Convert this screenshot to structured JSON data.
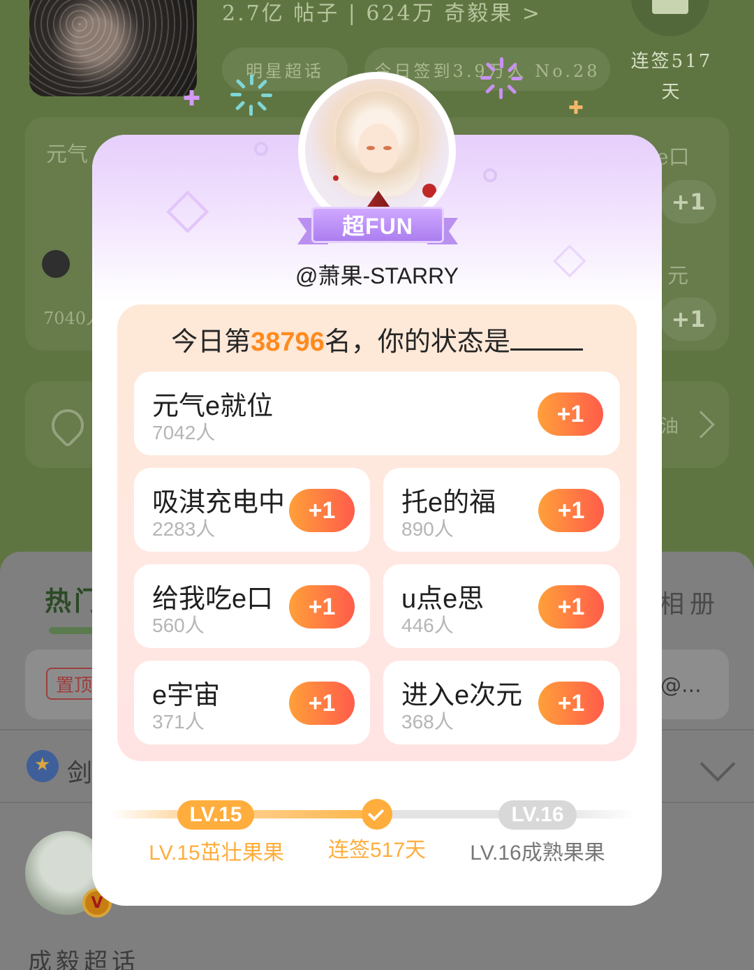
{
  "background": {
    "stats": "2.7亿 帖子 | 624万 奇毅果 >",
    "pill_star": "明星超话",
    "pill_checkin": "今日签到3.9万人 No.28",
    "streak": "连签517天",
    "left_card_title": "元气",
    "left_card_count": "7040人",
    "right_card_1": "e口",
    "right_card_2": "元",
    "right_plus": "+1",
    "edit_row_right": "油",
    "tab_hot": "热门",
    "tab_book": "相册",
    "pinned_tag": "置顶",
    "pinned_more": "@...",
    "post_author": "剑",
    "vip_badge": "V",
    "community": "成毅超话"
  },
  "popup": {
    "badge": "超FUN",
    "username": "@萧果-STARRY",
    "question_prefix": "今日第",
    "rank": "38796",
    "question_suffix": "名，你的状态是",
    "plus_label": "+1",
    "options": [
      {
        "label": "元气e就位",
        "count": "7042人"
      },
      {
        "label": "吸淇充电中",
        "count": "2283人"
      },
      {
        "label": "托e的福",
        "count": "890人"
      },
      {
        "label": "给我吃e口",
        "count": "560人"
      },
      {
        "label": "u点e思",
        "count": "446人"
      },
      {
        "label": "e宇宙",
        "count": "371人"
      },
      {
        "label": "进入e次元",
        "count": "368人"
      }
    ],
    "level": {
      "current_badge": "LV.15",
      "next_badge": "LV.16",
      "current_title": "LV.15茁壮果果",
      "streak_title": "连签517天",
      "next_title": "LV.16成熟果果"
    }
  },
  "colors": {
    "accent_orange": "#ff8a1f",
    "button_gradient_start": "#ffa03a",
    "button_gradient_end": "#ff5c4a",
    "badge_purple": "#b990ef",
    "panel_bg": "#fee8d6",
    "page_bg": "#5f7541"
  },
  "icons": [
    "edit-icon",
    "chevron-right-icon",
    "chevron-down-icon",
    "medal-icon",
    "diamond-icon",
    "check-icon",
    "shield-icon"
  ]
}
